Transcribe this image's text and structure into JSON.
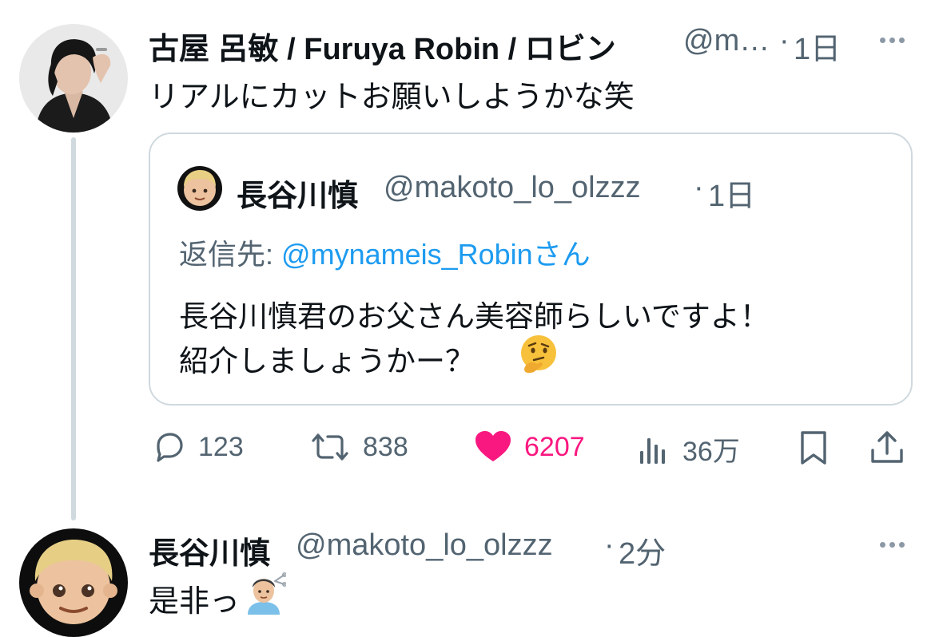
{
  "tweet1": {
    "name": "古屋 呂敏 / Furuya Robin / ロビン",
    "handle": "@m…",
    "separator": "·",
    "time": "1日",
    "text": "リアルにカットお願いしようかな笑"
  },
  "quote": {
    "name": "長谷川慎",
    "handle": "@makoto_lo_olzzz",
    "separator": "·",
    "time": "1日",
    "reply_prefix": "返信先:",
    "reply_mention": "@mynameis_Robin",
    "reply_suffix": "さん",
    "line1": "長谷川慎君のお父さん美容師らしいですよ！",
    "line2": "紹介しましょうかー？",
    "emoji": "thinking-face"
  },
  "actions": {
    "replies": "123",
    "retweets": "838",
    "likes": "6207",
    "views": "36万",
    "like_color": "#f91880"
  },
  "tweet2": {
    "name": "長谷川慎",
    "handle": "@makoto_lo_olzzz",
    "separator": "·",
    "time": "2分",
    "text": "是非っ",
    "emoji": "haircut-person"
  },
  "colors": {
    "secondary": "#536471",
    "link": "#1d9bf0",
    "border": "#cfd9de"
  }
}
